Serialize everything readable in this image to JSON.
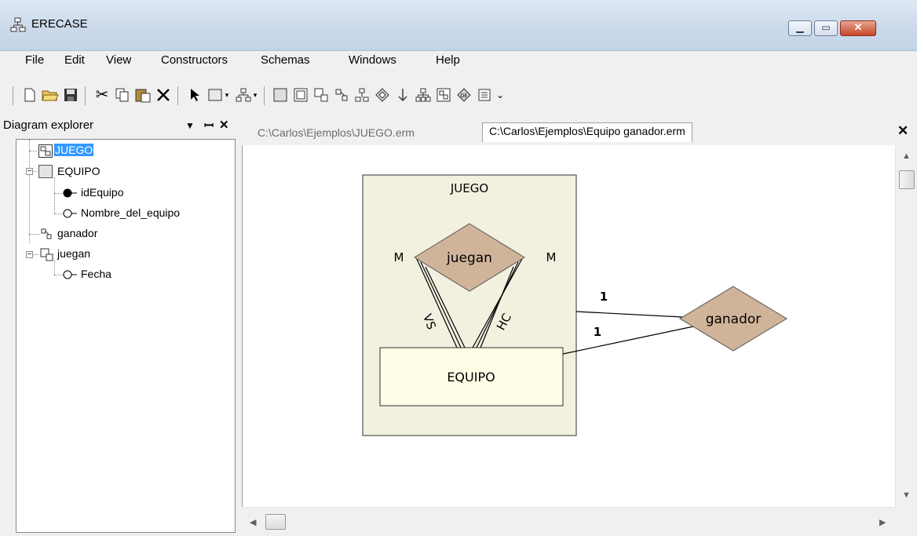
{
  "window": {
    "title": "ERECASE"
  },
  "menu": [
    "File",
    "Edit",
    "View",
    "Constructors",
    "Schemas",
    "Windows",
    "Help"
  ],
  "explorer": {
    "title": "Diagram explorer",
    "pin_icon": "pin-icon",
    "close_icon": "close-icon",
    "items": [
      {
        "label": "JUEGO",
        "icon": "aggregation-icon",
        "selected": true
      },
      {
        "label": "EQUIPO",
        "icon": "entity-icon"
      },
      {
        "label": "idEquipo",
        "icon": "key-attribute-icon"
      },
      {
        "label": "Nombre_del_equipo",
        "icon": "attribute-icon"
      },
      {
        "label": "ganador",
        "icon": "relationship-icon"
      },
      {
        "label": "juegan",
        "icon": "relationship-icon"
      },
      {
        "label": "Fecha",
        "icon": "attribute-icon"
      }
    ]
  },
  "tabs": [
    {
      "label": "C:\\Carlos\\Ejemplos\\JUEGO.erm",
      "active": false
    },
    {
      "label": "C:\\Carlos\\Ejemplos\\Equipo ganador.erm",
      "active": true
    }
  ],
  "diagram": {
    "aggregation_label": "JUEGO",
    "relationship_inner": "juegan",
    "entity": "EQUIPO",
    "relationship_outer": "ganador",
    "card_left": "M",
    "card_right": "M",
    "role_vs": "VS",
    "role_hc": "HC",
    "card_top": "1",
    "card_bottom": "1",
    "colors": {
      "aggregation_fill": "#f2f0df",
      "entity_fill": "#fefee6",
      "relationship_fill": "#d0b499"
    }
  }
}
